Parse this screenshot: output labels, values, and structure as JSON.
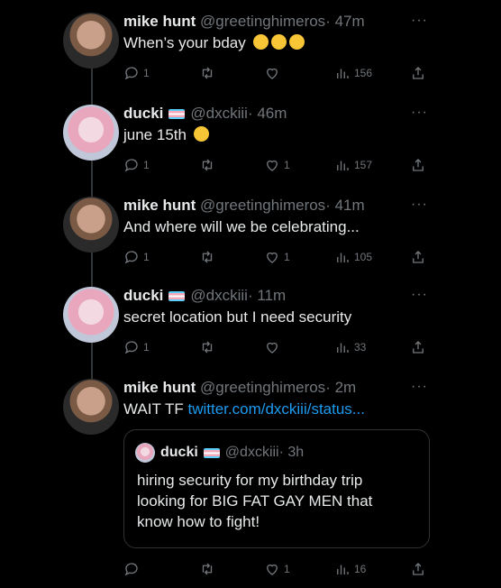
{
  "tweets": [
    {
      "name": "mike hunt",
      "handle": "@greetinghimeros",
      "time": "· 47m",
      "text": "When’s your bday",
      "emoji_count": 3,
      "counts": {
        "reply": "1",
        "retweet": "",
        "like": "",
        "views": "156"
      }
    },
    {
      "name": "ducki",
      "handle": "@dxckiii",
      "time": "· 46m",
      "text": "june 15th",
      "emoji_count": 1,
      "counts": {
        "reply": "1",
        "retweet": "",
        "like": "1",
        "views": "157"
      }
    },
    {
      "name": "mike hunt",
      "handle": "@greetinghimeros",
      "time": "· 41m",
      "text": "And where will we be celebrating...",
      "emoji_count": 0,
      "counts": {
        "reply": "1",
        "retweet": "",
        "like": "1",
        "views": "105"
      }
    },
    {
      "name": "ducki",
      "handle": "@dxckiii",
      "time": "· 11m",
      "text": "secret location but I need security",
      "emoji_count": 0,
      "counts": {
        "reply": "1",
        "retweet": "",
        "like": "",
        "views": "33"
      }
    },
    {
      "name": "mike hunt",
      "handle": "@greetinghimeros",
      "time": "· 2m",
      "text": "WAIT TF",
      "link": "twitter.com/dxckiii/status...",
      "counts": {
        "reply": "",
        "retweet": "",
        "like": "1",
        "views": "16"
      }
    }
  ],
  "quote": {
    "name": "ducki",
    "handle": "@dxckiii",
    "time": "· 3h",
    "lines": [
      "hiring security for my birthday trip",
      "looking for BIG FAT GAY MEN that",
      "know how to fight!"
    ]
  },
  "more_label": "···"
}
